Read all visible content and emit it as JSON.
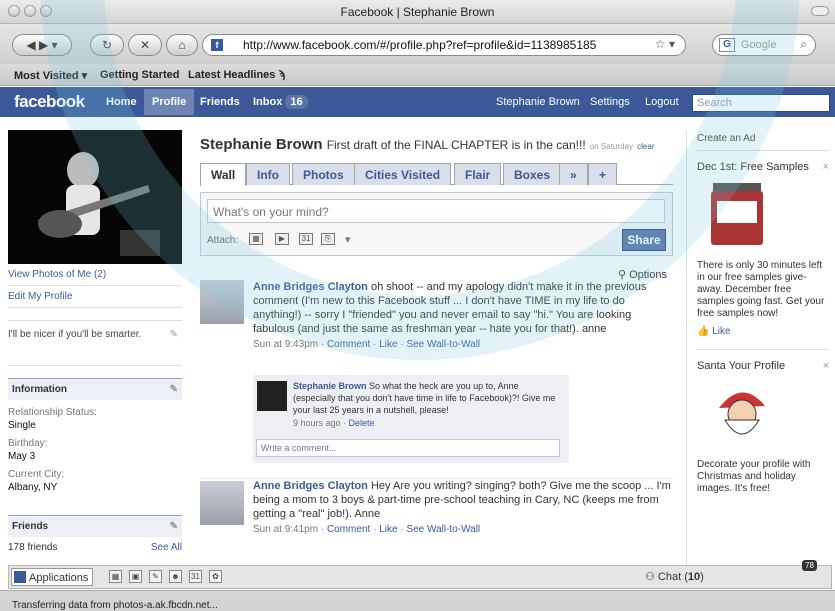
{
  "browser": {
    "window_title": "Facebook | Stephanie Brown",
    "url": "http://www.facebook.com/#/profile.php?ref=profile&id=1138985185",
    "search_placeholder": "Google",
    "bookmarks": [
      "Most Visited",
      "Getting Started",
      "Latest Headlines"
    ],
    "status_text": "Transferring data from photos-a.ak.fbcdn.net..."
  },
  "fb_header": {
    "logo": "facebook",
    "nav": [
      "Home",
      "Profile",
      "Friends",
      "Inbox"
    ],
    "inbox_count": "16",
    "user_name": "Stephanie Brown",
    "settings": "Settings",
    "logout": "Logout",
    "search_placeholder": "Search"
  },
  "left": {
    "links": [
      "View Photos of Me (2)",
      "Edit My Profile"
    ],
    "status": "I'll be nicer if you'll be smarter.",
    "info_heading": "Information",
    "info": [
      {
        "label": "Relationship Status:",
        "value": "Single"
      },
      {
        "label": "Birthday:",
        "value": "May 3"
      },
      {
        "label": "Current City:",
        "value": "Albany, NY"
      }
    ],
    "friends_heading": "Friends",
    "friends_count": "178 friends",
    "see_all": "See All"
  },
  "profile": {
    "name": "Stephanie Brown",
    "status": "First draft of the FINAL CHAPTER is in the can!!!",
    "status_time": "on Saturday",
    "status_clear": "clear",
    "tabs": [
      "Wall",
      "Info",
      "Photos",
      "Cities Visited",
      "Flair",
      "Boxes",
      "»",
      "+"
    ]
  },
  "composer": {
    "placeholder": "What's on your mind?",
    "attach_label": "Attach:",
    "share": "Share"
  },
  "options_label": "Options",
  "posts": [
    {
      "author": "Anne Bridges Clayton",
      "text": "oh shoot -- and my apology didn't make it in the previous comment (I'm new to this Facebook stuff ... I don't have TIME in my life to do anything!) -- sorry I \"friended\" you and never email to say \"hi.\" You are looking fabulous (and just the same as freshman year -- hate you for that!). anne",
      "time": "Sun at 9:43pm",
      "actions": [
        "Comment",
        "Like",
        "See Wall-to-Wall"
      ],
      "comment": {
        "author": "Stephanie Brown",
        "text": "So what the heck are you up to, Anne (especially that you don't have time in life to Facebook)?! Give me your last 25 years in a nutshell, please!",
        "time": "9 hours ago",
        "action": "Delete"
      },
      "comment_placeholder": "Write a comment..."
    },
    {
      "author": "Anne Bridges Clayton",
      "text": "Hey Are you writing? singing? both? Give me the scoop ... I'm being a mom to 3 boys & part-time pre-school teaching in Cary, NC (keeps me from getting a \"real\" job!). Anne",
      "time": "Sun at 9:41pm",
      "actions": [
        "Comment",
        "Like",
        "See Wall-to-Wall"
      ]
    }
  ],
  "ads": {
    "create": "Create an Ad",
    "items": [
      {
        "title": "Dec 1st: Free Samples",
        "text": "There is only 30 minutes left in our free samples give-away. December free samples going fast. Get your free samples now!",
        "like": "Like",
        "close": "×"
      },
      {
        "title": "Santa Your Profile",
        "text": "Decorate your profile with Christmas and holiday images. It's free!",
        "close": "×"
      }
    ]
  },
  "footer": {
    "applications": "Applications",
    "chat": "Chat",
    "chat_count": "10",
    "notif_count": "78"
  }
}
